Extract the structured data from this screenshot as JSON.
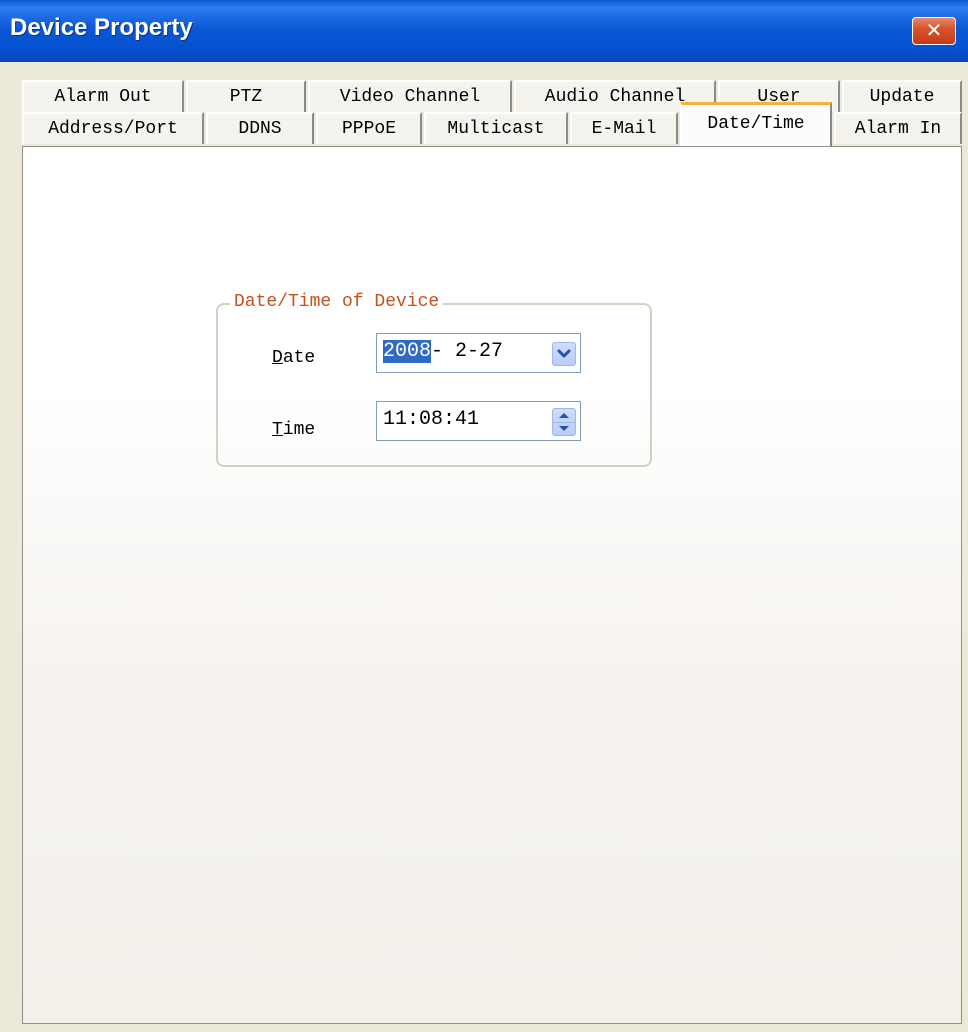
{
  "window": {
    "title": "Device Property"
  },
  "tabs": {
    "row_back": [
      {
        "label": "Alarm Out"
      },
      {
        "label": "PTZ"
      },
      {
        "label": "Video Channel"
      },
      {
        "label": "Audio Channel"
      },
      {
        "label": "User"
      },
      {
        "label": "Update"
      }
    ],
    "row_front": [
      {
        "label": "Address/Port"
      },
      {
        "label": "DDNS"
      },
      {
        "label": "PPPoE"
      },
      {
        "label": "Multicast"
      },
      {
        "label": "E-Mail"
      },
      {
        "label": "Date/Time"
      },
      {
        "label": "Alarm In"
      }
    ],
    "active": "Date/Time"
  },
  "datetime_group": {
    "legend": "Date/Time of Device",
    "date": {
      "label_accel": "D",
      "label_rest": "ate",
      "year_selected": "2008",
      "rest": "- 2-27"
    },
    "time": {
      "label_accel": "T",
      "label_rest": "ime",
      "value": "11:08:41"
    }
  },
  "colors": {
    "titlebar": "#0451cf",
    "legend_text": "#c7501b",
    "active_tab_accent": "#f5b23d",
    "selection": "#316ac5"
  },
  "icons": {
    "close": "close-icon",
    "date_dropdown": "chevron-down-icon",
    "time_spinner": "spinner-arrows-icon"
  }
}
